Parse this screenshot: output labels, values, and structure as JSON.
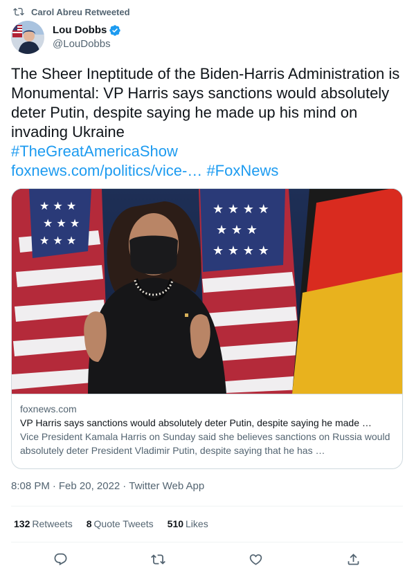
{
  "retweet": {
    "label": "Carol Abreu Retweeted"
  },
  "author": {
    "display_name": "Lou Dobbs",
    "handle": "@LouDobbs"
  },
  "tweet": {
    "body": "The Sheer Ineptitude of the Biden-Harris Administration is Monumental: VP Harris says sanctions would absolutely deter Putin, despite saying he made up his mind on invading Ukraine",
    "hashtag1": "#TheGreatAmericaShow",
    "url": "foxnews.com/politics/vice-…",
    "hashtag2": "#FoxNews"
  },
  "card": {
    "domain": "foxnews.com",
    "title": "VP Harris says sanctions would absolutely deter Putin, despite saying he made …",
    "description": "Vice President Kamala Harris on Sunday said she believes sanctions on Russia would absolutely deter President Vladimir Putin, despite saying that he has …"
  },
  "meta": {
    "time": "8:08 PM",
    "sep1": "·",
    "date": "Feb 20, 2022",
    "sep2": "·",
    "source": "Twitter Web App"
  },
  "stats": {
    "retweets_count": "132",
    "retweets_label": "Retweets",
    "quotes_count": "8",
    "quotes_label": "Quote Tweets",
    "likes_count": "510",
    "likes_label": "Likes"
  },
  "icons": {
    "retweet_indicator": "retweet-icon",
    "verified": "verified-badge-icon",
    "reply": "reply-icon",
    "retweet": "retweet-icon",
    "like": "heart-icon",
    "share": "share-icon"
  },
  "colors": {
    "link": "#1d9bf0",
    "secondary_text": "#536471",
    "primary_text": "#0f1419",
    "border": "#cfd9de"
  }
}
